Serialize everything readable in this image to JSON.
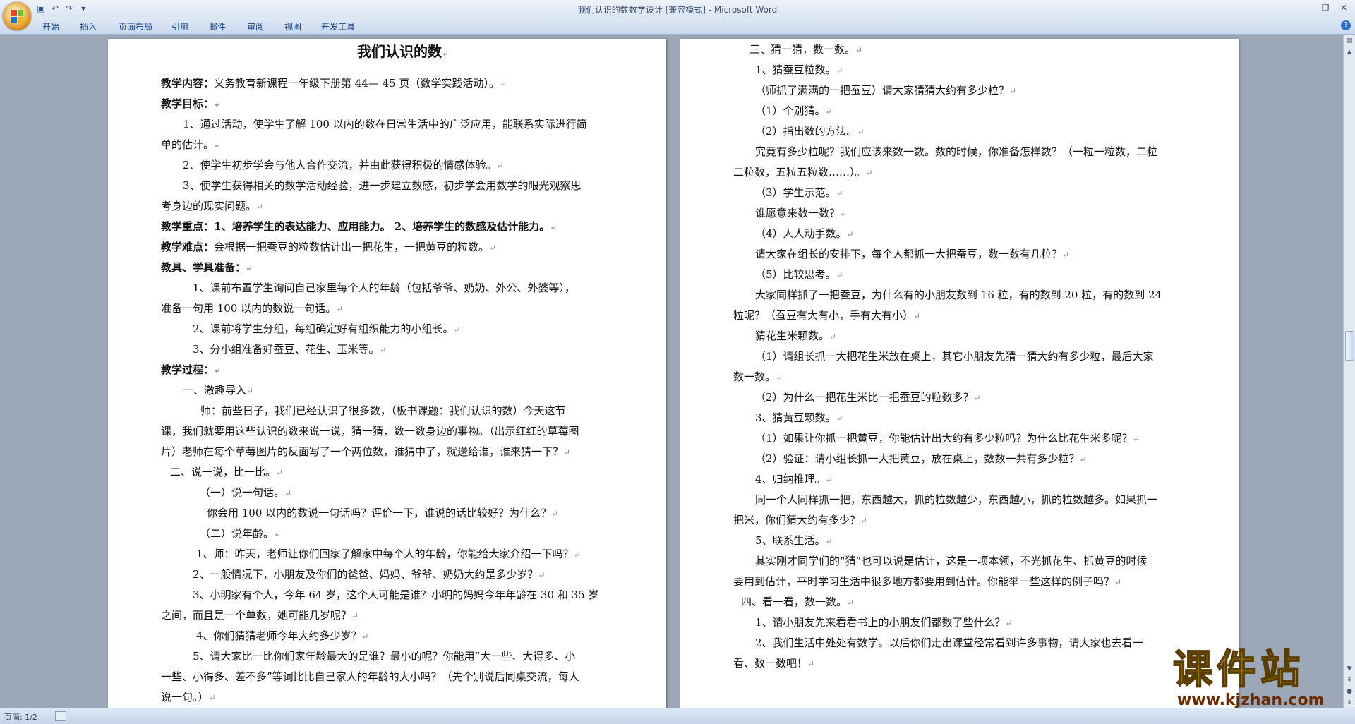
{
  "window": {
    "title": "我们认识的数数学设计 [兼容模式] - Microsoft Word"
  },
  "ribbon": {
    "tabs": [
      "开始",
      "插入",
      "页面布局",
      "引用",
      "邮件",
      "审阅",
      "视图",
      "开发工具"
    ]
  },
  "status": {
    "page": "页面: 1/2"
  },
  "watermark": {
    "brand": "课件站",
    "url": "www.kjzhan.com"
  },
  "page1": {
    "title": "我们认识的数",
    "lines": [
      "义务教育新课程一年级下册第 44— 45 页（数学实践活动）。",
      "1、通过活动，使学生了解 100 以内的数在日常生活中的广泛应用，能联系实际进行简",
      "单的估计。",
      "2、使学生初步学会与他人合作交流，并由此获得积极的情感体验。",
      "3、使学生获得相关的数学活动经验，进一步建立数感，初步学会用数学的眼光观察思",
      "考身边的现实问题。",
      "1、培养学生的表达能力、应用能力。          2、培养学生的数感及估计能力。",
      "会根据一把蚕豆的粒数估计出一把花生，一把黄豆的粒数。",
      "1、课前布置学生询问自己家里每个人的年龄（包括爷爷、奶奶、外公、外婆等），",
      "准备一句用 100 以内的数说一句话。",
      "2、课前将学生分组，每组确定好有组织能力的小组长。",
      "3、分小组准备好蚕豆、花生、玉米等。",
      "一、激趣导入",
      "师：前些日子，我们已经认识了很多数，（板书课题：我们认识的数）今天这节",
      "课，我们就要用这些认识的数来说一说，猜一猜，数一数身边的事物。（出示红红的草莓图",
      "片）老师在每个草莓图片的反面写了一个两位数，谁猜中了，就送给谁，谁来猜一下？",
      "二、说一说，比一比。",
      "（一）说一句话。",
      "你会用 100 以内的数说一句话吗？评价一下，谁说的话比较好？为什么？",
      "（二）说年龄。",
      "1、师：昨天，老师让你们回家了解家中每个人的年龄，你能给大家介绍一下吗？",
      "2、一般情况下，小朋友及你们的爸爸、妈妈、爷爷、奶奶大约是多少岁？",
      "3、小明家有个人，今年 64 岁，这个人可能是谁？小明的妈妈今年年龄在 30 和 35 岁",
      "之间，而且是一个单数，她可能几岁呢？",
      "4、你们猜猜老师今年大约多少岁？",
      "5、请大家比一比你们家年龄最大的是谁？最小的呢？你能用“大一些、大得多、小",
      "一些、小得多、差不多”等词比比自己家人的年龄的大小吗？（先个别说后同桌交流，每人",
      "说一句。）"
    ],
    "labels": [
      "教学内容：",
      "教学目标：",
      "教学重点：",
      "教学难点：",
      "教具、学具准备：",
      "教学过程："
    ]
  },
  "page2": {
    "lines": [
      "三、猜一猜，数一数。",
      "1、猜蚕豆粒数。",
      "（师抓了满满的一把蚕豆）请大家猜猜大约有多少粒？",
      "（1）个别猜。",
      "（2）指出数的方法。",
      "究竟有多少粒呢？我们应该来数一数。数的时候，你准备怎样数？（一粒一粒数，二粒",
      "二粒数，五粒五粒数……）。",
      "（3）学生示范。",
      "谁愿意来数一数？",
      "（4）人人动手数。",
      "请大家在组长的安排下，每个人都抓一大把蚕豆，数一数有几粒？",
      "（5）比较思考。",
      "大家同样抓了一把蚕豆，为什么有的小朋友数到 16 粒，有的数到 20 粒，有的数到 24",
      "粒呢？（蚕豆有大有小，手有大有小）",
      "猜花生米颗数。",
      "（1）请组长抓一大把花生米放在桌上，其它小朋友先猜一猜大约有多少粒，最后大家",
      "数一数。",
      "（2）为什么一把花生米比一把蚕豆的粒数多？",
      "3、猜黄豆颗数。",
      "（1）如果让你抓一把黄豆，你能估计出大约有多少粒吗？为什么比花生米多呢？",
      "（2）验证：请小组长抓一大把黄豆，放在桌上，数数一共有多少粒？",
      "4、归纳推理。",
      "同一个人同样抓一把，东西越大，抓的粒数越少，东西越小，抓的粒数越多。如果抓一",
      "把米，你们猜大约有多少？",
      "5、联系生活。",
      "其实刚才同学们的“猜”也可以说是估计，这是一项本领，不光抓花生、抓黄豆的时候",
      "要用到估计，平时学习生活中很多地方都要用到估计。你能举一些这样的例子吗？",
      "四、看一看，数一数。",
      "1、请小朋友先来看看书上的小朋友们都数了些什么？",
      "2、我们生活中处处有数学。以后你们走出课堂经常看到许多事物，请大家也去看一",
      "看、数一数吧！"
    ]
  }
}
